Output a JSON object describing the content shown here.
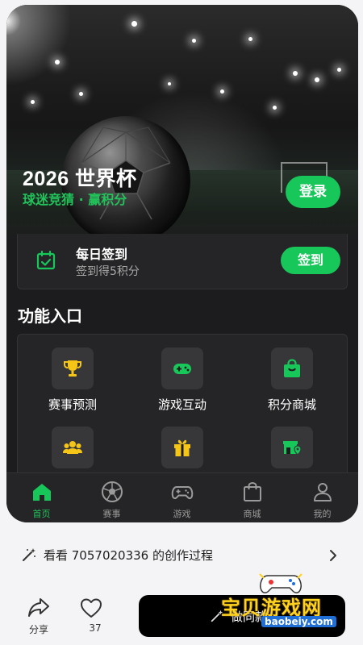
{
  "hero": {
    "title": "2026 世界杯",
    "subtitle": "球迷竞猜 · 赢积分",
    "login_label": "登录"
  },
  "signin": {
    "title": "每日签到",
    "subtitle": "签到得5积分",
    "button_label": "签到"
  },
  "features": {
    "section_title": "功能入口",
    "items": [
      {
        "label": "赛事预测",
        "icon": "trophy-icon"
      },
      {
        "label": "游戏互动",
        "icon": "gamepad-icon"
      },
      {
        "label": "积分商城",
        "icon": "shopping-bag-icon"
      },
      {
        "label": "",
        "icon": "users-icon"
      },
      {
        "label": "",
        "icon": "gift-icon"
      },
      {
        "label": "",
        "icon": "store-location-icon"
      }
    ]
  },
  "tabbar": {
    "items": [
      {
        "label": "首页",
        "icon": "home-icon",
        "active": true
      },
      {
        "label": "赛事",
        "icon": "football-icon",
        "active": false
      },
      {
        "label": "游戏",
        "icon": "gamepad-icon",
        "active": false
      },
      {
        "label": "商城",
        "icon": "shopping-bag-icon",
        "active": false
      },
      {
        "label": "我的",
        "icon": "user-icon",
        "active": false
      }
    ]
  },
  "creation": {
    "text": "看看 7057020336 的创作过程"
  },
  "actions": {
    "share_label": "分享",
    "like_count": "37",
    "do_button_label": "做同款"
  },
  "watermark": {
    "text": "宝贝游戏网",
    "url": "baobeiy.com"
  },
  "colors": {
    "accent": "#17c75a",
    "icon_yellow": "#f5c518",
    "background": "#1c1c1e"
  }
}
